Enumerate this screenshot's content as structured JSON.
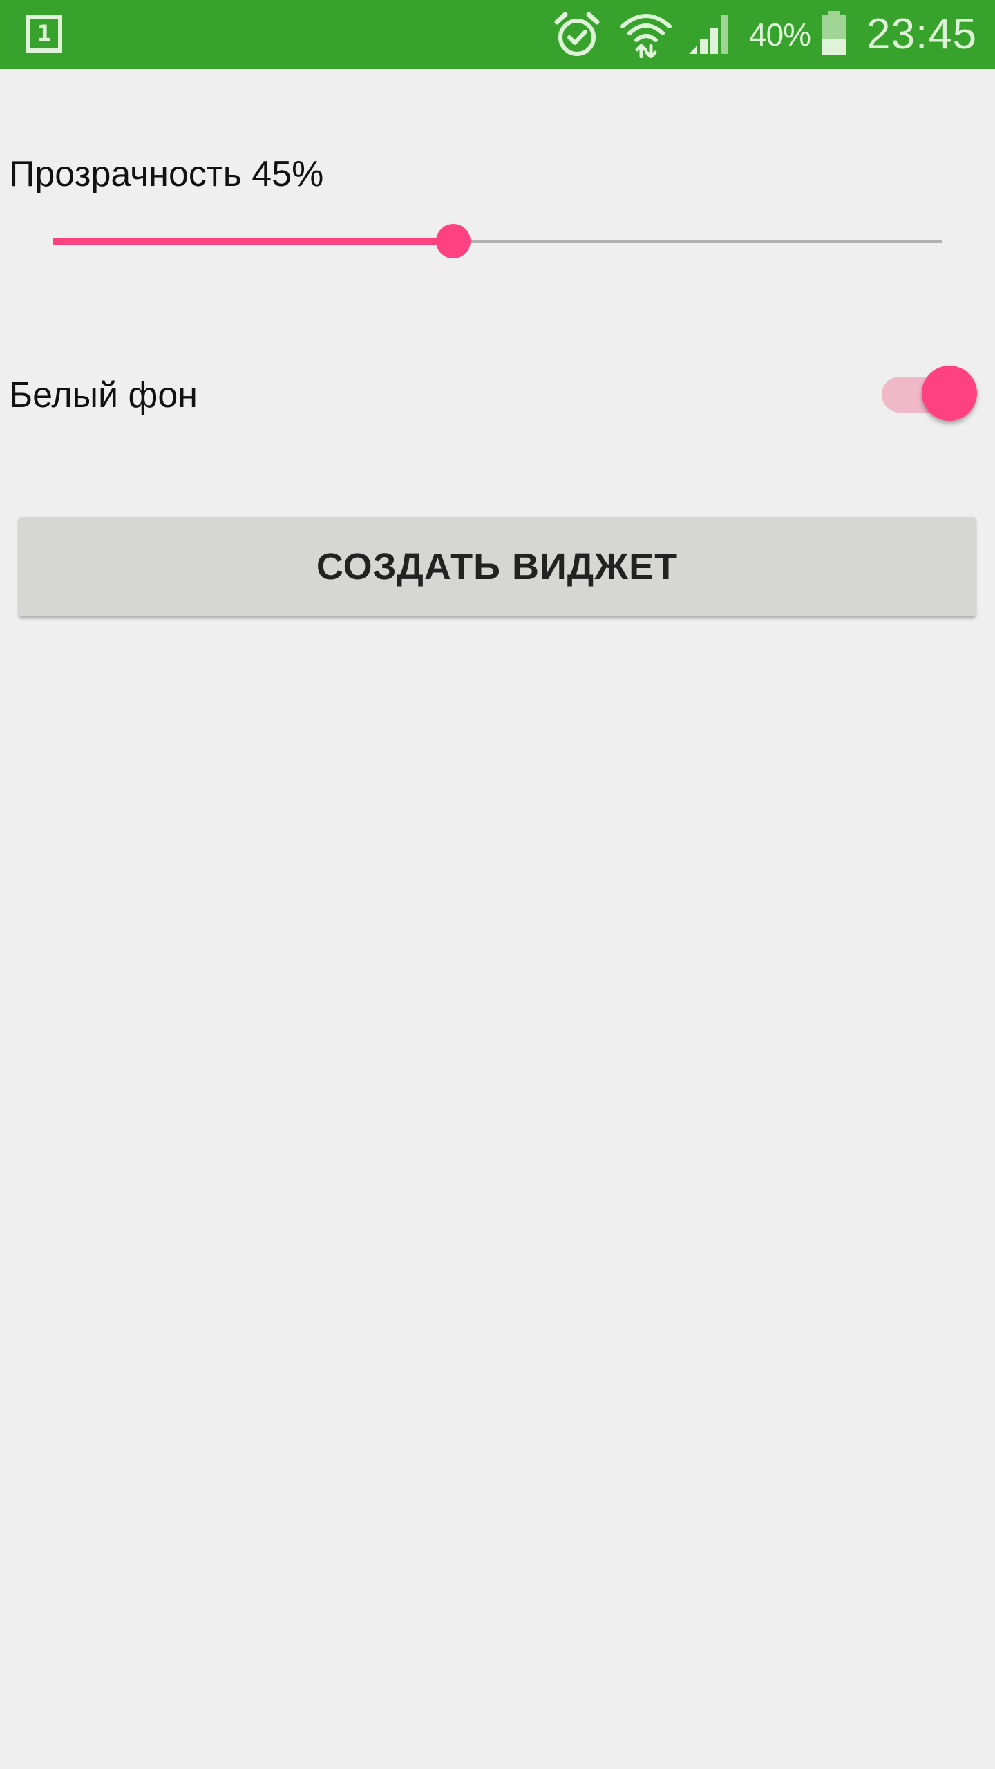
{
  "status_bar": {
    "notification_icon": "calendar-1-icon",
    "notification_number": "1",
    "icons": [
      "alarm-icon",
      "wifi-icon",
      "signal-icon",
      "battery-icon"
    ],
    "battery_percent": "40%",
    "time": "23:45",
    "background_color": "#37a22c"
  },
  "transparency": {
    "label": "Прозрачность 45%",
    "value_percent": 45,
    "accent_color": "#ff4081"
  },
  "white_background": {
    "label": "Белый фон",
    "enabled": true
  },
  "create_button": {
    "label": "СОЗДАТЬ ВИДЖЕТ"
  }
}
